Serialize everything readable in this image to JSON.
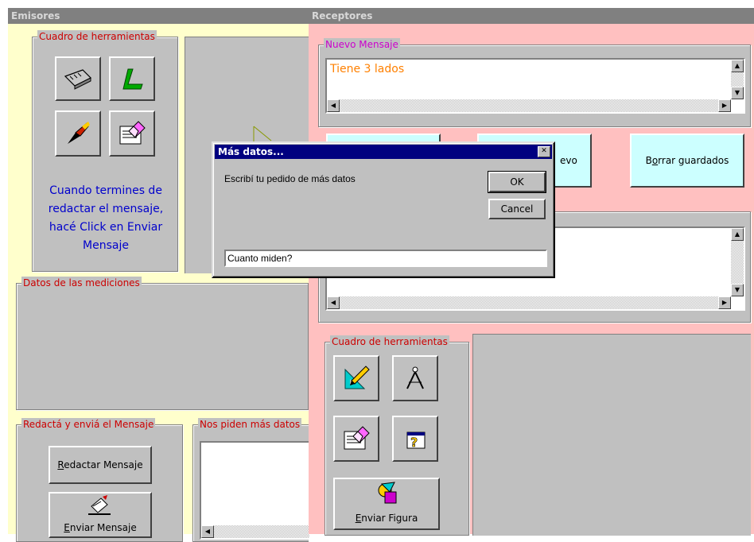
{
  "emisores": {
    "title": "Emisores",
    "toolbox": {
      "legend": "Cuadro de herramientas",
      "instructions": "Cuando termines de redactar el mensaje, hacé Click en Enviar Mensaje"
    },
    "mediciones": {
      "legend": "Datos de las mediciones"
    },
    "redacta": {
      "legend": "Redactá y enviá el Mensaje",
      "redactar_prefix": "",
      "redactar_u": "R",
      "redactar_rest": "edactar Mensaje",
      "enviar_u": "E",
      "enviar_rest": "nviar Mensaje"
    },
    "piden": {
      "legend": "Nos piden más datos"
    }
  },
  "receptores": {
    "title": "Receptores",
    "nuevo_mensaje": {
      "legend": "Nuevo Mensaje",
      "text": "Tiene 3 lados"
    },
    "buttons": {
      "middle_visible": "evo",
      "borrar_pre": "B",
      "borrar_u": "o",
      "borrar_rest": "rrar guardados"
    },
    "toolbox": {
      "legend": "Cuadro de herramientas",
      "enviar_u": "E",
      "enviar_rest": "nviar Figura"
    }
  },
  "dialog": {
    "title": "Más datos...",
    "prompt": "Escribí tu pedido de más datos",
    "ok": "OK",
    "cancel": "Cancel",
    "input_value": "Cuanto miden?",
    "close": "✕"
  },
  "colors": {
    "emisores_bg": "#ffffcc",
    "receptores_bg": "#ffc0c0",
    "panel_gray": "#c0c0c0",
    "legend_red": "#cc0000",
    "legend_magenta": "#cc00cc",
    "instructions_blue": "#0000cc",
    "message_orange": "#ff8000",
    "dialog_title": "#000080"
  }
}
